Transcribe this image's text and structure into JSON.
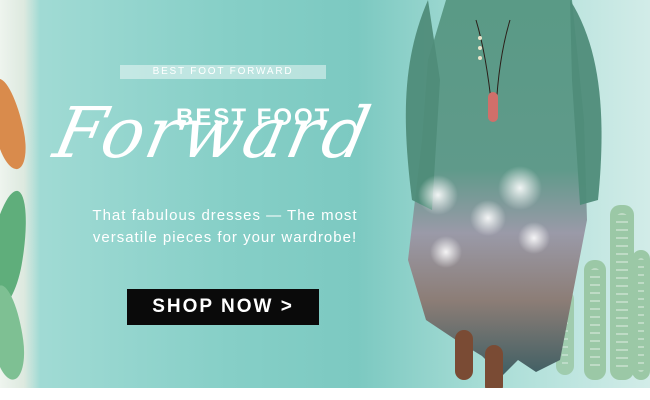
{
  "promo": {
    "tag": "BEST FOOT FORWARD",
    "headline": "BEST FOOT",
    "headline_script": "Forward",
    "subcopy": "That fabulous dresses — The most versatile pieces for your wardrobe!",
    "cta_label": "SHOP NOW >"
  },
  "colors": {
    "background_teal": "#86cfc7",
    "cta_background": "#0a0a0a",
    "text": "#ffffff"
  }
}
